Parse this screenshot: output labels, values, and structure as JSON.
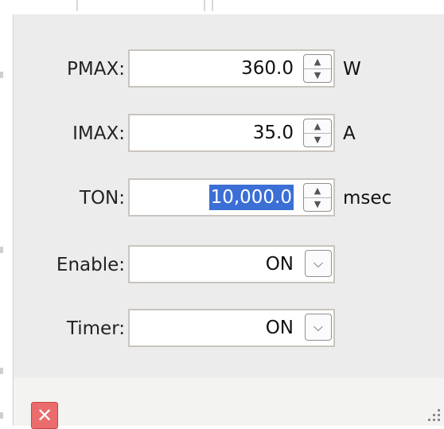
{
  "form": {
    "rows": [
      {
        "label": "PMAX:",
        "value": "360.0",
        "unit": "W",
        "control": "spinner"
      },
      {
        "label": "IMAX:",
        "value": "35.0",
        "unit": "A",
        "control": "spinner"
      },
      {
        "label": "TON:",
        "value": "10,000.0",
        "unit": "msec",
        "control": "spinner",
        "selected": true
      },
      {
        "label": "Enable:",
        "value": "ON",
        "unit": "",
        "control": "dropdown"
      },
      {
        "label": "Timer:",
        "value": "ON",
        "unit": "",
        "control": "dropdown"
      }
    ]
  },
  "icons": {
    "close": "close-icon",
    "spin_up": "chevron-up-icon",
    "spin_down": "chevron-down-icon",
    "dropdown": "chevron-down-icon",
    "resize": "resize-grip-icon"
  },
  "colors": {
    "selection": "#3b6fd6",
    "close_button": "#ea6c6c",
    "panel_bg": "#ececec"
  }
}
